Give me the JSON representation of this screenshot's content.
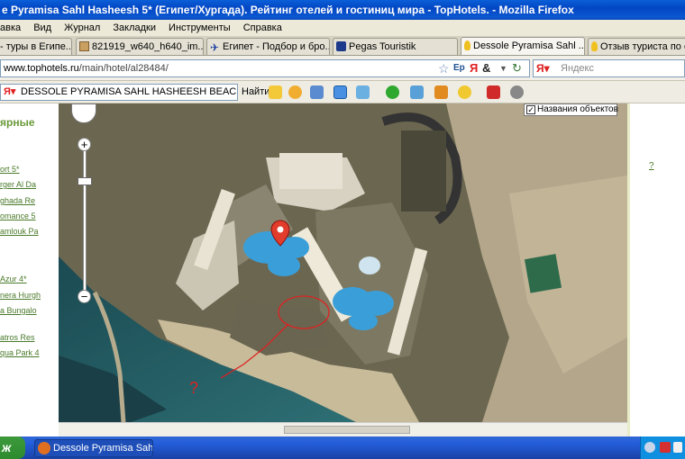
{
  "window": {
    "title": "e Pyramisa Sahl Hasheesh 5* (Египет/Хургада). Рейтинг отелей и гостиниц мира - TopHotels. - Mozilla Firefox"
  },
  "menu": [
    "авка",
    "Вид",
    "Журнал",
    "Закладки",
    "Инструменты",
    "Справка"
  ],
  "tabs": [
    {
      "label": "- туры в Египе...",
      "active": false
    },
    {
      "label": "821919_w640_h640_im...",
      "active": false
    },
    {
      "label": "Египет - Подбор и бро...",
      "active": false
    },
    {
      "label": "Pegas Touristik",
      "active": false
    },
    {
      "label": "Dessole Pyramisa Sahl ...",
      "active": true
    },
    {
      "label": "Отзыв туриста по от",
      "active": false
    }
  ],
  "address": {
    "domain": "www.tophotels.ru",
    "path": "/main/hotel/al28484/"
  },
  "search": {
    "placeholder": "Яндекс"
  },
  "toolbar": {
    "search_value": "DESSOLE PYRAMISA SAHL HASHEESH BEACH RESORT",
    "find_label": "Найти"
  },
  "left_panel": {
    "heading": "ярные",
    "links": [
      "ort 5*",
      "rger Al Da",
      "ghada Re",
      "omance 5",
      "amlouk Pa",
      "Azur 4*",
      "nera Hurgh",
      "a Bungalo",
      "atros Res",
      "qua Park 4"
    ]
  },
  "right_panel": {
    "link": "?"
  },
  "map": {
    "object_names_label": "Названия объектов",
    "object_names_checked": true,
    "checkmark": "✓",
    "annotation": "?"
  },
  "taskbar": {
    "start_label": "ж",
    "item_label": "Dessole Pyramisa Sah..."
  },
  "colors": {
    "titlebar": "#0a5fd8",
    "link_green": "#4a7a2a",
    "marker": "#e23c2c",
    "pool": "#3c9ed8"
  }
}
